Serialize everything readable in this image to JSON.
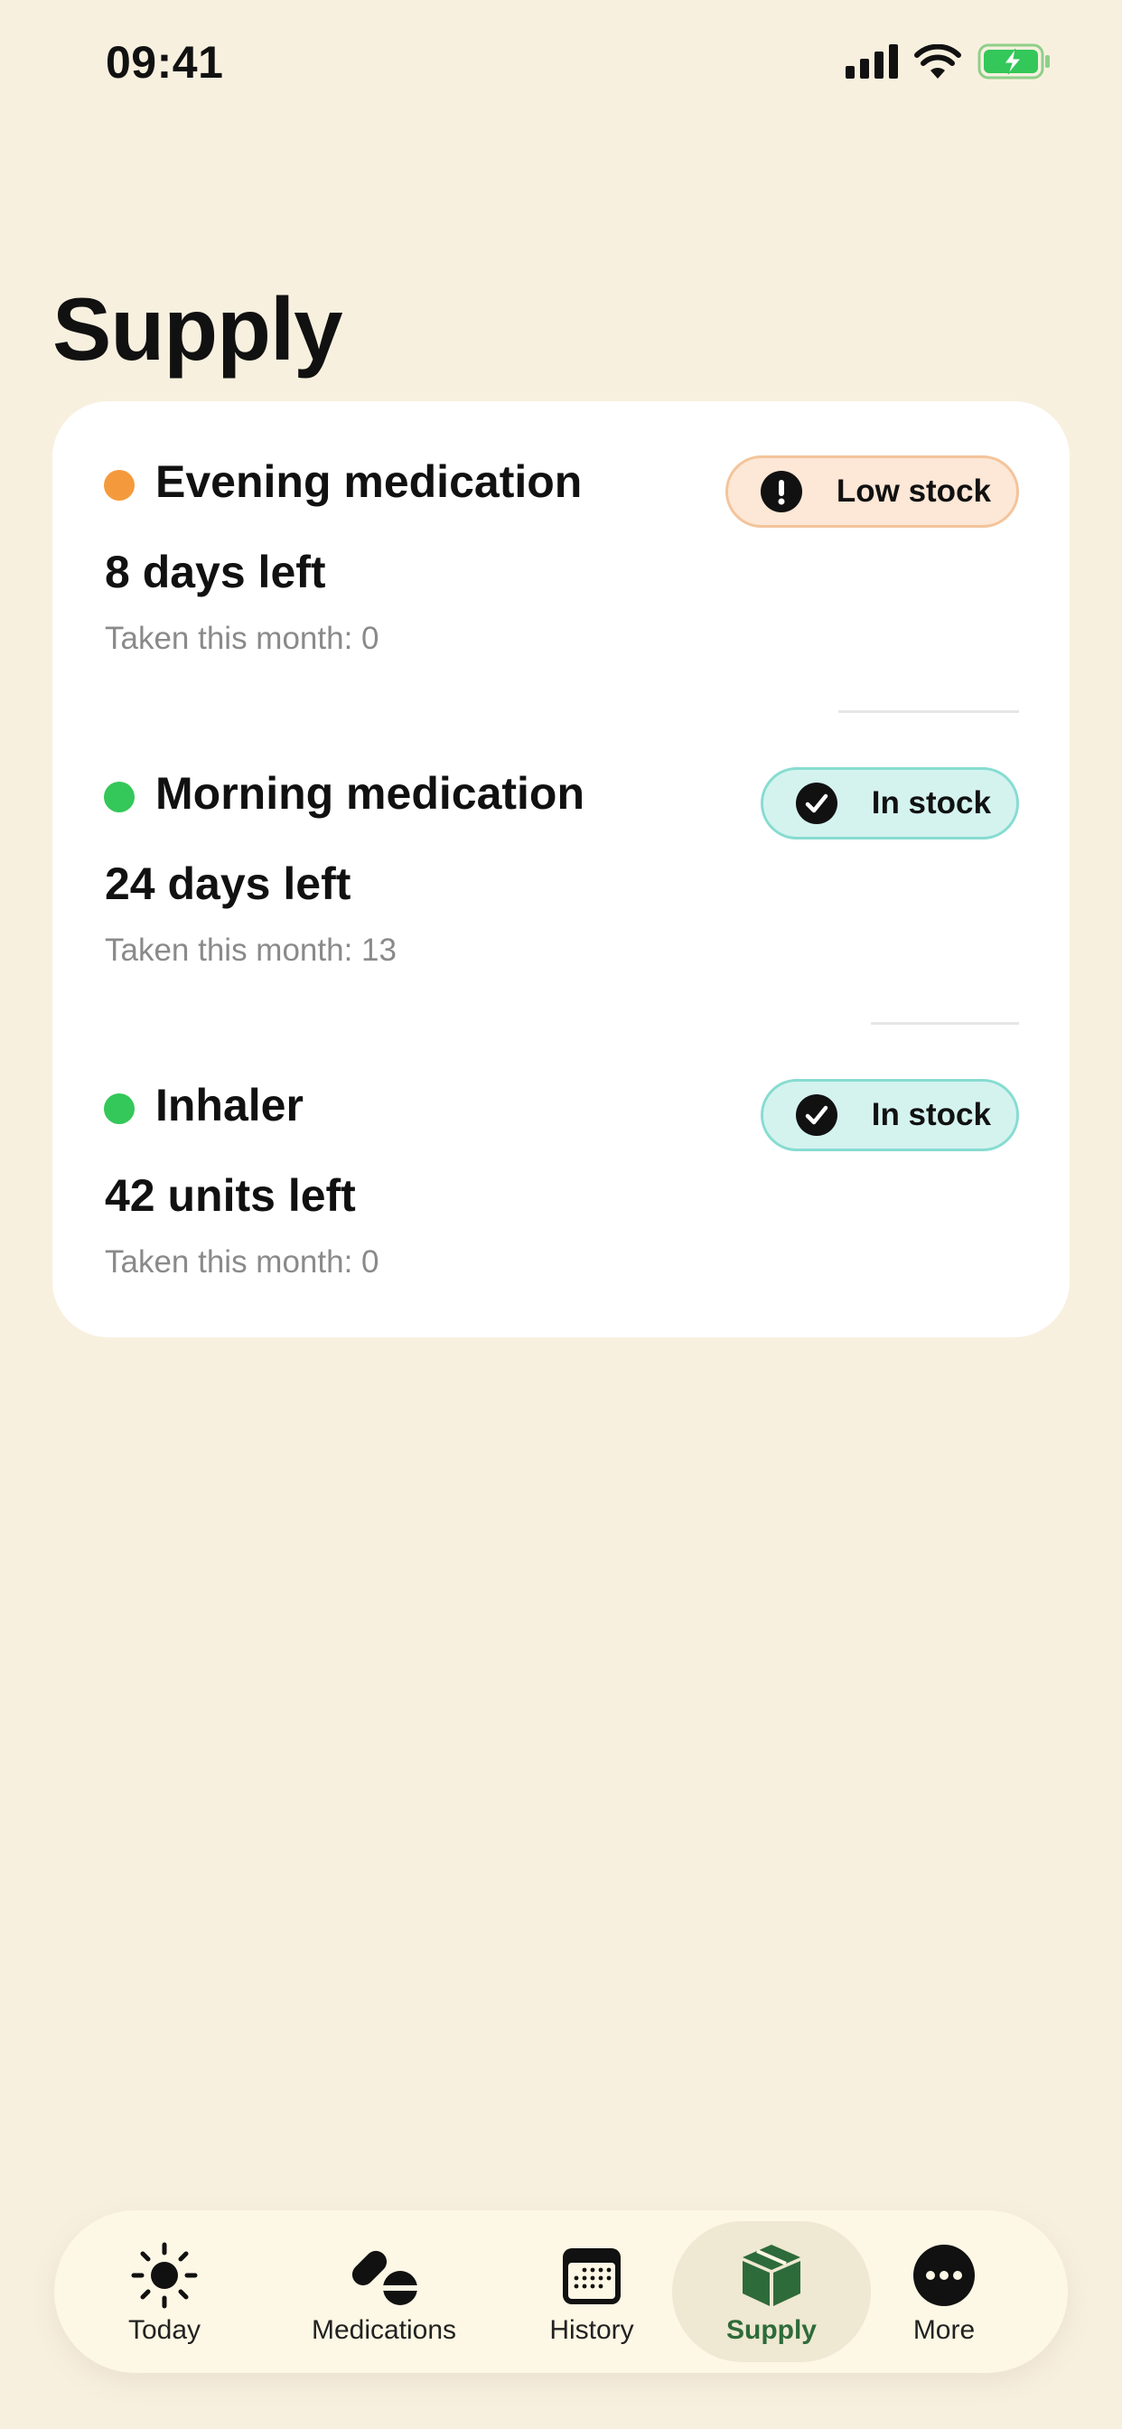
{
  "status_bar": {
    "time": "09:41"
  },
  "page": {
    "title": "Supply"
  },
  "items": [
    {
      "name": "Evening medication",
      "remaining": "8 days left",
      "taken": "Taken this month: 0",
      "status": "Low stock",
      "status_icon": "exclamation-icon",
      "dot_color": "#f59a3c"
    },
    {
      "name": "Morning medication",
      "remaining": "24 days left",
      "taken": "Taken this month: 13",
      "status": "In stock",
      "status_icon": "checkmark-icon",
      "dot_color": "#34c759"
    },
    {
      "name": "Inhaler",
      "remaining": "42 units left",
      "taken": "Taken this month: 0",
      "status": "In stock",
      "status_icon": "checkmark-icon",
      "dot_color": "#34c759"
    }
  ],
  "tab_bar": {
    "tabs": [
      {
        "label": "Today",
        "icon": "sun-icon"
      },
      {
        "label": "Medications",
        "icon": "pills-icon"
      },
      {
        "label": "History",
        "icon": "calendar-icon"
      },
      {
        "label": "Supply",
        "icon": "box-icon",
        "active": true
      },
      {
        "label": "More",
        "icon": "ellipsis-icon"
      }
    ]
  },
  "colors": {
    "background": "#f8f0df",
    "card": "#ffffff",
    "low_stock_bg": "#fde7d6",
    "in_stock_bg": "#d4f3ef",
    "accent": "#2e6b3a"
  }
}
